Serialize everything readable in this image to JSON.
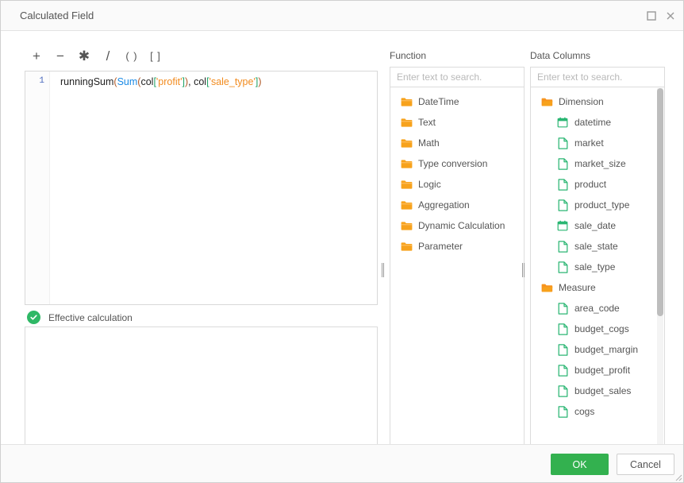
{
  "window": {
    "title": "Calculated Field",
    "maximize_icon": "maximize-icon",
    "close_icon": "close-icon"
  },
  "toolbar": {
    "operators": [
      {
        "name": "plus-operator",
        "glyph": "+"
      },
      {
        "name": "minus-operator",
        "glyph": "−"
      },
      {
        "name": "multiply-operator",
        "glyph": "✱"
      },
      {
        "name": "divide-operator",
        "glyph": "/"
      },
      {
        "name": "parentheses-operator",
        "glyph": "( )"
      },
      {
        "name": "brackets-operator",
        "glyph": "[ ]"
      }
    ]
  },
  "editor": {
    "line_number": "1",
    "formula": "runningSum(Sum(col['profit']), col['sale_type'])",
    "tokens": [
      {
        "text": "runningSum",
        "cls": "tok-fn"
      },
      {
        "text": "(",
        "cls": "tok-paren"
      },
      {
        "text": "Sum",
        "cls": "tok-agg"
      },
      {
        "text": "(",
        "cls": "tok-paren"
      },
      {
        "text": "col",
        "cls": "tok-plain"
      },
      {
        "text": "[",
        "cls": "tok-brk"
      },
      {
        "text": "'profit'",
        "cls": "tok-str"
      },
      {
        "text": "]",
        "cls": "tok-brk"
      },
      {
        "text": ")",
        "cls": "tok-paren"
      },
      {
        "text": ", ",
        "cls": "tok-plain"
      },
      {
        "text": "col",
        "cls": "tok-plain"
      },
      {
        "text": "[",
        "cls": "tok-brk"
      },
      {
        "text": "'sale_type'",
        "cls": "tok-str"
      },
      {
        "text": "]",
        "cls": "tok-brk"
      },
      {
        "text": ")",
        "cls": "tok-paren"
      }
    ]
  },
  "status": {
    "icon": "check-circle-icon",
    "text": "Effective calculation",
    "color": "#2fb866"
  },
  "preview": {
    "content": ""
  },
  "function_panel": {
    "title": "Function",
    "search_placeholder": "Enter text to search.",
    "search_value": "",
    "items": [
      {
        "label": "DateTime",
        "icon": "folder-icon",
        "level": 0
      },
      {
        "label": "Text",
        "icon": "folder-icon",
        "level": 0
      },
      {
        "label": "Math",
        "icon": "folder-icon",
        "level": 0
      },
      {
        "label": "Type conversion",
        "icon": "folder-icon",
        "level": 0
      },
      {
        "label": "Logic",
        "icon": "folder-icon",
        "level": 0
      },
      {
        "label": "Aggregation",
        "icon": "folder-icon",
        "level": 0
      },
      {
        "label": "Dynamic Calculation",
        "icon": "folder-icon",
        "level": 0
      },
      {
        "label": "Parameter",
        "icon": "folder-icon",
        "level": 0
      }
    ]
  },
  "data_columns_panel": {
    "title": "Data Columns",
    "search_placeholder": "Enter text to search.",
    "search_value": "",
    "scroll_thumb_percent": 62,
    "items": [
      {
        "label": "Dimension",
        "icon": "folder-open-icon",
        "level": 0
      },
      {
        "label": "datetime",
        "icon": "calendar-icon",
        "level": 1
      },
      {
        "label": "market",
        "icon": "text-field-icon",
        "level": 1
      },
      {
        "label": "market_size",
        "icon": "text-field-icon",
        "level": 1
      },
      {
        "label": "product",
        "icon": "text-field-icon",
        "level": 1
      },
      {
        "label": "product_type",
        "icon": "text-field-icon",
        "level": 1
      },
      {
        "label": "sale_date",
        "icon": "calendar-icon",
        "level": 1
      },
      {
        "label": "sale_state",
        "icon": "text-field-icon",
        "level": 1
      },
      {
        "label": "sale_type",
        "icon": "text-field-icon",
        "level": 1
      },
      {
        "label": "Measure",
        "icon": "folder-open-icon",
        "level": 0
      },
      {
        "label": "area_code",
        "icon": "text-field-icon",
        "level": 1
      },
      {
        "label": "budget_cogs",
        "icon": "text-field-icon",
        "level": 1
      },
      {
        "label": "budget_margin",
        "icon": "text-field-icon",
        "level": 1
      },
      {
        "label": "budget_profit",
        "icon": "text-field-icon",
        "level": 1
      },
      {
        "label": "budget_sales",
        "icon": "text-field-icon",
        "level": 1
      },
      {
        "label": "cogs",
        "icon": "text-field-icon",
        "level": 1
      }
    ]
  },
  "footer": {
    "ok_label": "OK",
    "cancel_label": "Cancel",
    "ok_color": "#33b14f"
  }
}
